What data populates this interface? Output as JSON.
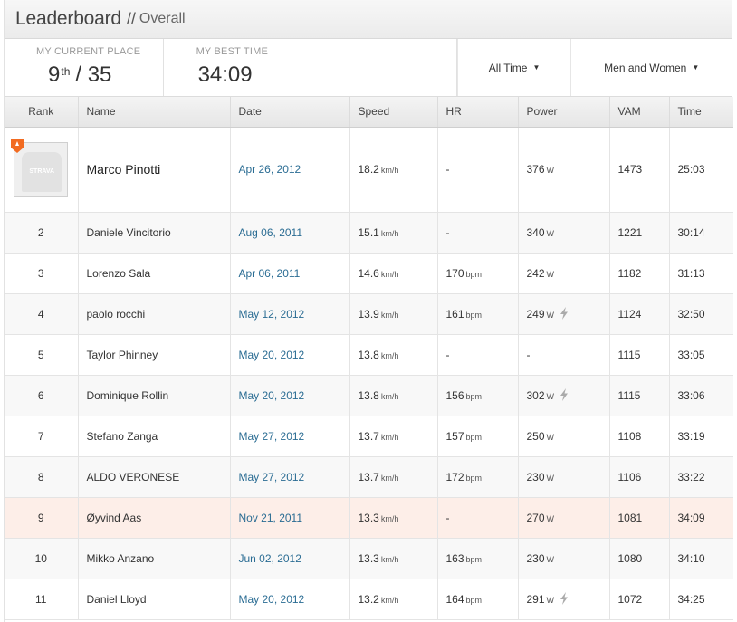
{
  "header": {
    "title": "Leaderboard",
    "separator": "//",
    "subtitle": "Overall"
  },
  "stats": {
    "place_label": "MY CURRENT PLACE",
    "place_value": "9",
    "place_suffix": "th",
    "place_total": "/ 35",
    "best_label": "MY BEST TIME",
    "best_value": "34:09"
  },
  "filters": {
    "time": "All Time",
    "gender": "Men and Women"
  },
  "columns": [
    "Rank",
    "Name",
    "Date",
    "Speed",
    "HR",
    "Power",
    "VAM",
    "Time"
  ],
  "units": {
    "speed": "km/h",
    "hr": "bpm",
    "power": "W"
  },
  "avatar_text": "STRAVA",
  "rows": [
    {
      "rank": "",
      "name": "Marco Pinotti",
      "date": "Apr 26, 2012",
      "speed": "18.2",
      "hr": "-",
      "power": "376",
      "vam": "1473",
      "time": "25:03"
    },
    {
      "rank": "2",
      "name": "Daniele Vincitorio",
      "date": "Aug 06, 2011",
      "speed": "15.1",
      "hr": "-",
      "power": "340",
      "vam": "1221",
      "time": "30:14"
    },
    {
      "rank": "3",
      "name": "Lorenzo Sala",
      "date": "Apr 06, 2011",
      "speed": "14.6",
      "hr": "170",
      "power": "242",
      "vam": "1182",
      "time": "31:13"
    },
    {
      "rank": "4",
      "name": "paolo rocchi",
      "date": "May 12, 2012",
      "speed": "13.9",
      "hr": "161",
      "power": "249",
      "vam": "1124",
      "time": "32:50"
    },
    {
      "rank": "5",
      "name": "Taylor Phinney",
      "date": "May 20, 2012",
      "speed": "13.8",
      "hr": "-",
      "power": "-",
      "vam": "1115",
      "time": "33:05"
    },
    {
      "rank": "6",
      "name": "Dominique Rollin",
      "date": "May 20, 2012",
      "speed": "13.8",
      "hr": "156",
      "power": "302",
      "vam": "1115",
      "time": "33:06"
    },
    {
      "rank": "7",
      "name": "Stefano Zanga",
      "date": "May 27, 2012",
      "speed": "13.7",
      "hr": "157",
      "power": "250",
      "vam": "1108",
      "time": "33:19"
    },
    {
      "rank": "8",
      "name": "ALDO VERONESE",
      "date": "May 27, 2012",
      "speed": "13.7",
      "hr": "172",
      "power": "230",
      "vam": "1106",
      "time": "33:22"
    },
    {
      "rank": "9",
      "name": "Øyvind Aas",
      "date": "Nov 21, 2011",
      "speed": "13.3",
      "hr": "-",
      "power": "270",
      "vam": "1081",
      "time": "34:09"
    },
    {
      "rank": "10",
      "name": "Mikko Anzano",
      "date": "Jun 02, 2012",
      "speed": "13.3",
      "hr": "163",
      "power": "230",
      "vam": "1080",
      "time": "34:10"
    },
    {
      "rank": "11",
      "name": "Daniel Lloyd",
      "date": "May 20, 2012",
      "speed": "13.2",
      "hr": "164",
      "power": "291",
      "vam": "1072",
      "time": "34:25"
    }
  ],
  "power_meter_rows": [
    3,
    5,
    10
  ],
  "highlight_row": 8,
  "colors": {
    "link": "#2a6c93",
    "highlight": "#fdeee8",
    "badge": "#f26b21"
  }
}
